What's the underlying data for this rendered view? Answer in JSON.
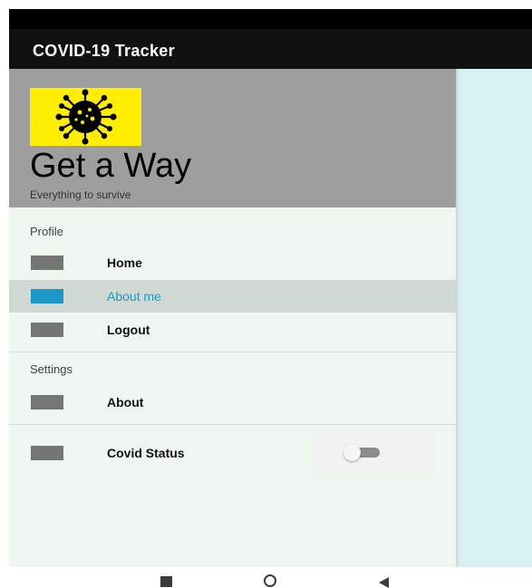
{
  "app": {
    "title": "COVID-19 Tracker"
  },
  "drawer": {
    "header": {
      "title": "Get a Way",
      "subtitle": "Everything to survive"
    },
    "sections": [
      {
        "label": "Profile",
        "items": [
          {
            "label": "Home",
            "selected": false
          },
          {
            "label": "About me",
            "selected": true
          },
          {
            "label": "Logout",
            "selected": false
          }
        ]
      },
      {
        "label": "Settings",
        "items": [
          {
            "label": "About",
            "selected": false
          }
        ]
      }
    ],
    "covid_status": {
      "label": "Covid Status",
      "enabled": false
    }
  },
  "colors": {
    "accent": "#1b98c8",
    "header_bg": "#9e9e9e",
    "drawer_bg": "#eef6ef",
    "content_bg": "#d8f1f4",
    "logo_bg": "#ffee00"
  },
  "nav_icons": [
    "recents-icon",
    "home-icon",
    "back-icon"
  ]
}
